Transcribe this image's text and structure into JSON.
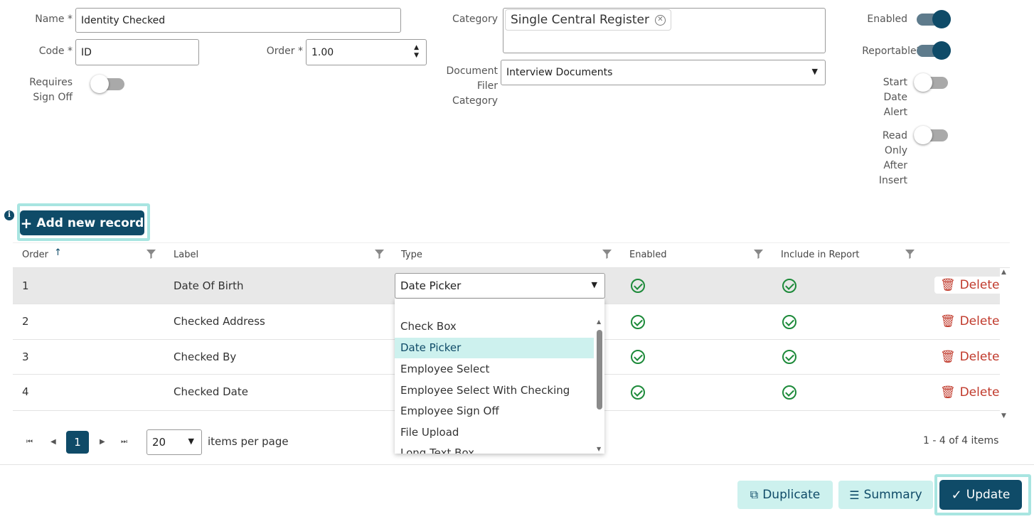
{
  "form": {
    "name_label": "Name *",
    "name_value": "Identity Checked",
    "code_label": "Code *",
    "code_value": "ID",
    "order_label": "Order *",
    "order_value": "1.00",
    "requires_signoff_label_1": "Requires",
    "requires_signoff_label_2": "Sign Off",
    "category_label": "Category",
    "category_chip": "Single Central Register",
    "doc_filer_label_1": "Document",
    "doc_filer_label_2": "Filer",
    "doc_filer_label_3": "Category",
    "doc_filer_value": "Interview Documents",
    "enabled_label": "Enabled",
    "reportable_label": "Reportable?",
    "start_date_alert_1": "Start",
    "start_date_alert_2": "Date",
    "start_date_alert_3": "Alert",
    "read_only_1": "Read",
    "read_only_2": "Only",
    "read_only_3": "After",
    "read_only_4": "Insert"
  },
  "toggles": {
    "requires_signoff": false,
    "enabled": true,
    "reportable": true,
    "start_date_alert": false,
    "read_only_after_insert": false
  },
  "toolbar": {
    "add_label": "Add new record"
  },
  "grid": {
    "columns": [
      "Order",
      "Label",
      "Type",
      "Enabled",
      "Include in Report"
    ],
    "rows": [
      {
        "order": "1",
        "label": "Date Of Birth",
        "type": "Date Picker",
        "enabled": true,
        "include": true,
        "delete": "Delete"
      },
      {
        "order": "2",
        "label": "Checked Address",
        "type": "",
        "enabled": true,
        "include": true,
        "delete": "Delete"
      },
      {
        "order": "3",
        "label": "Checked By",
        "type": "",
        "enabled": true,
        "include": true,
        "delete": "Delete"
      },
      {
        "order": "4",
        "label": "Checked Date",
        "type": "",
        "enabled": true,
        "include": true,
        "delete": "Delete"
      }
    ],
    "type_options": [
      "Check Box",
      "Date Picker",
      "Employee Select",
      "Employee Select With Checking",
      "Employee Sign Off",
      "File Upload",
      "Long Text Box"
    ],
    "selected_type": "Date Picker"
  },
  "pager": {
    "current_page": "1",
    "page_size": "20",
    "items_per_page_label": "items per page",
    "summary": "1 - 4 of 4 items"
  },
  "actions": {
    "duplicate": "Duplicate",
    "summary": "Summary",
    "update": "Update"
  },
  "colors": {
    "primary": "#0f4b68",
    "accent_light": "#cdf1ee",
    "focus": "#a8e5e1",
    "danger": "#c0392b",
    "success": "#1d8a3a"
  }
}
